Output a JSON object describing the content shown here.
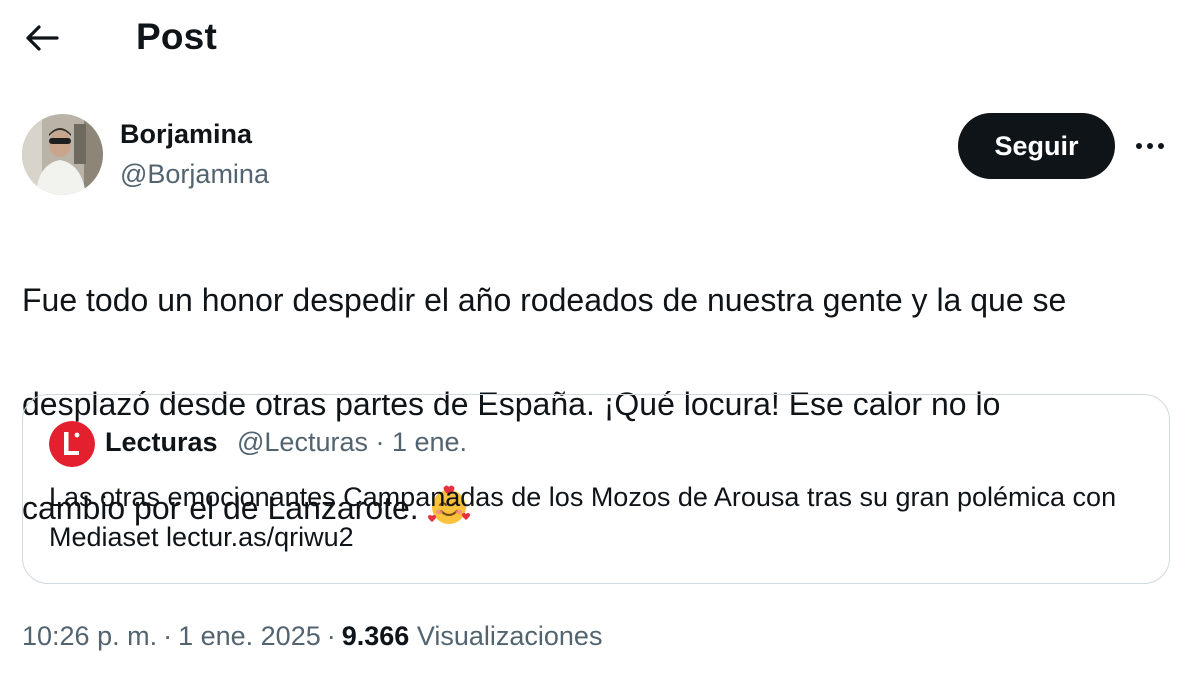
{
  "header": {
    "back_icon": "arrow-left-icon",
    "title": "Post"
  },
  "author": {
    "name": "Borjamina",
    "handle": "@Borjamina",
    "avatar_icon": "user-avatar"
  },
  "actions": {
    "follow_label": "Seguir",
    "more_icon": "ellipsis-icon"
  },
  "post": {
    "text_line1": "Fue todo un honor despedir el año rodeados de nuestra gente y la que se",
    "text_line2": "desplazó desde otras partes de España. ¡Qué locura! Ese calor no lo",
    "text_line3": "cambio por el de Lanzarote.",
    "emoji_icon": "smiling-face-with-hearts-icon"
  },
  "quote": {
    "avatar_icon": "lecturas-logo",
    "name": "Lecturas",
    "handle": "@Lecturas",
    "date": "1 ene.",
    "text": "Las otras emocionantes Campanadas de los Mozos de Arousa tras su gran polémica con Mediaset lectur.as/qriwu2"
  },
  "footer": {
    "time": "10:26 p. m.",
    "date": "1 ene. 2025",
    "views_count": "9.366",
    "views_label": "Visualizaciones"
  },
  "colors": {
    "text_primary": "#0f1419",
    "text_secondary": "#536471",
    "border": "#cfd9de",
    "follow_bg": "#0f1419",
    "lecturas_red": "#e4202e"
  }
}
